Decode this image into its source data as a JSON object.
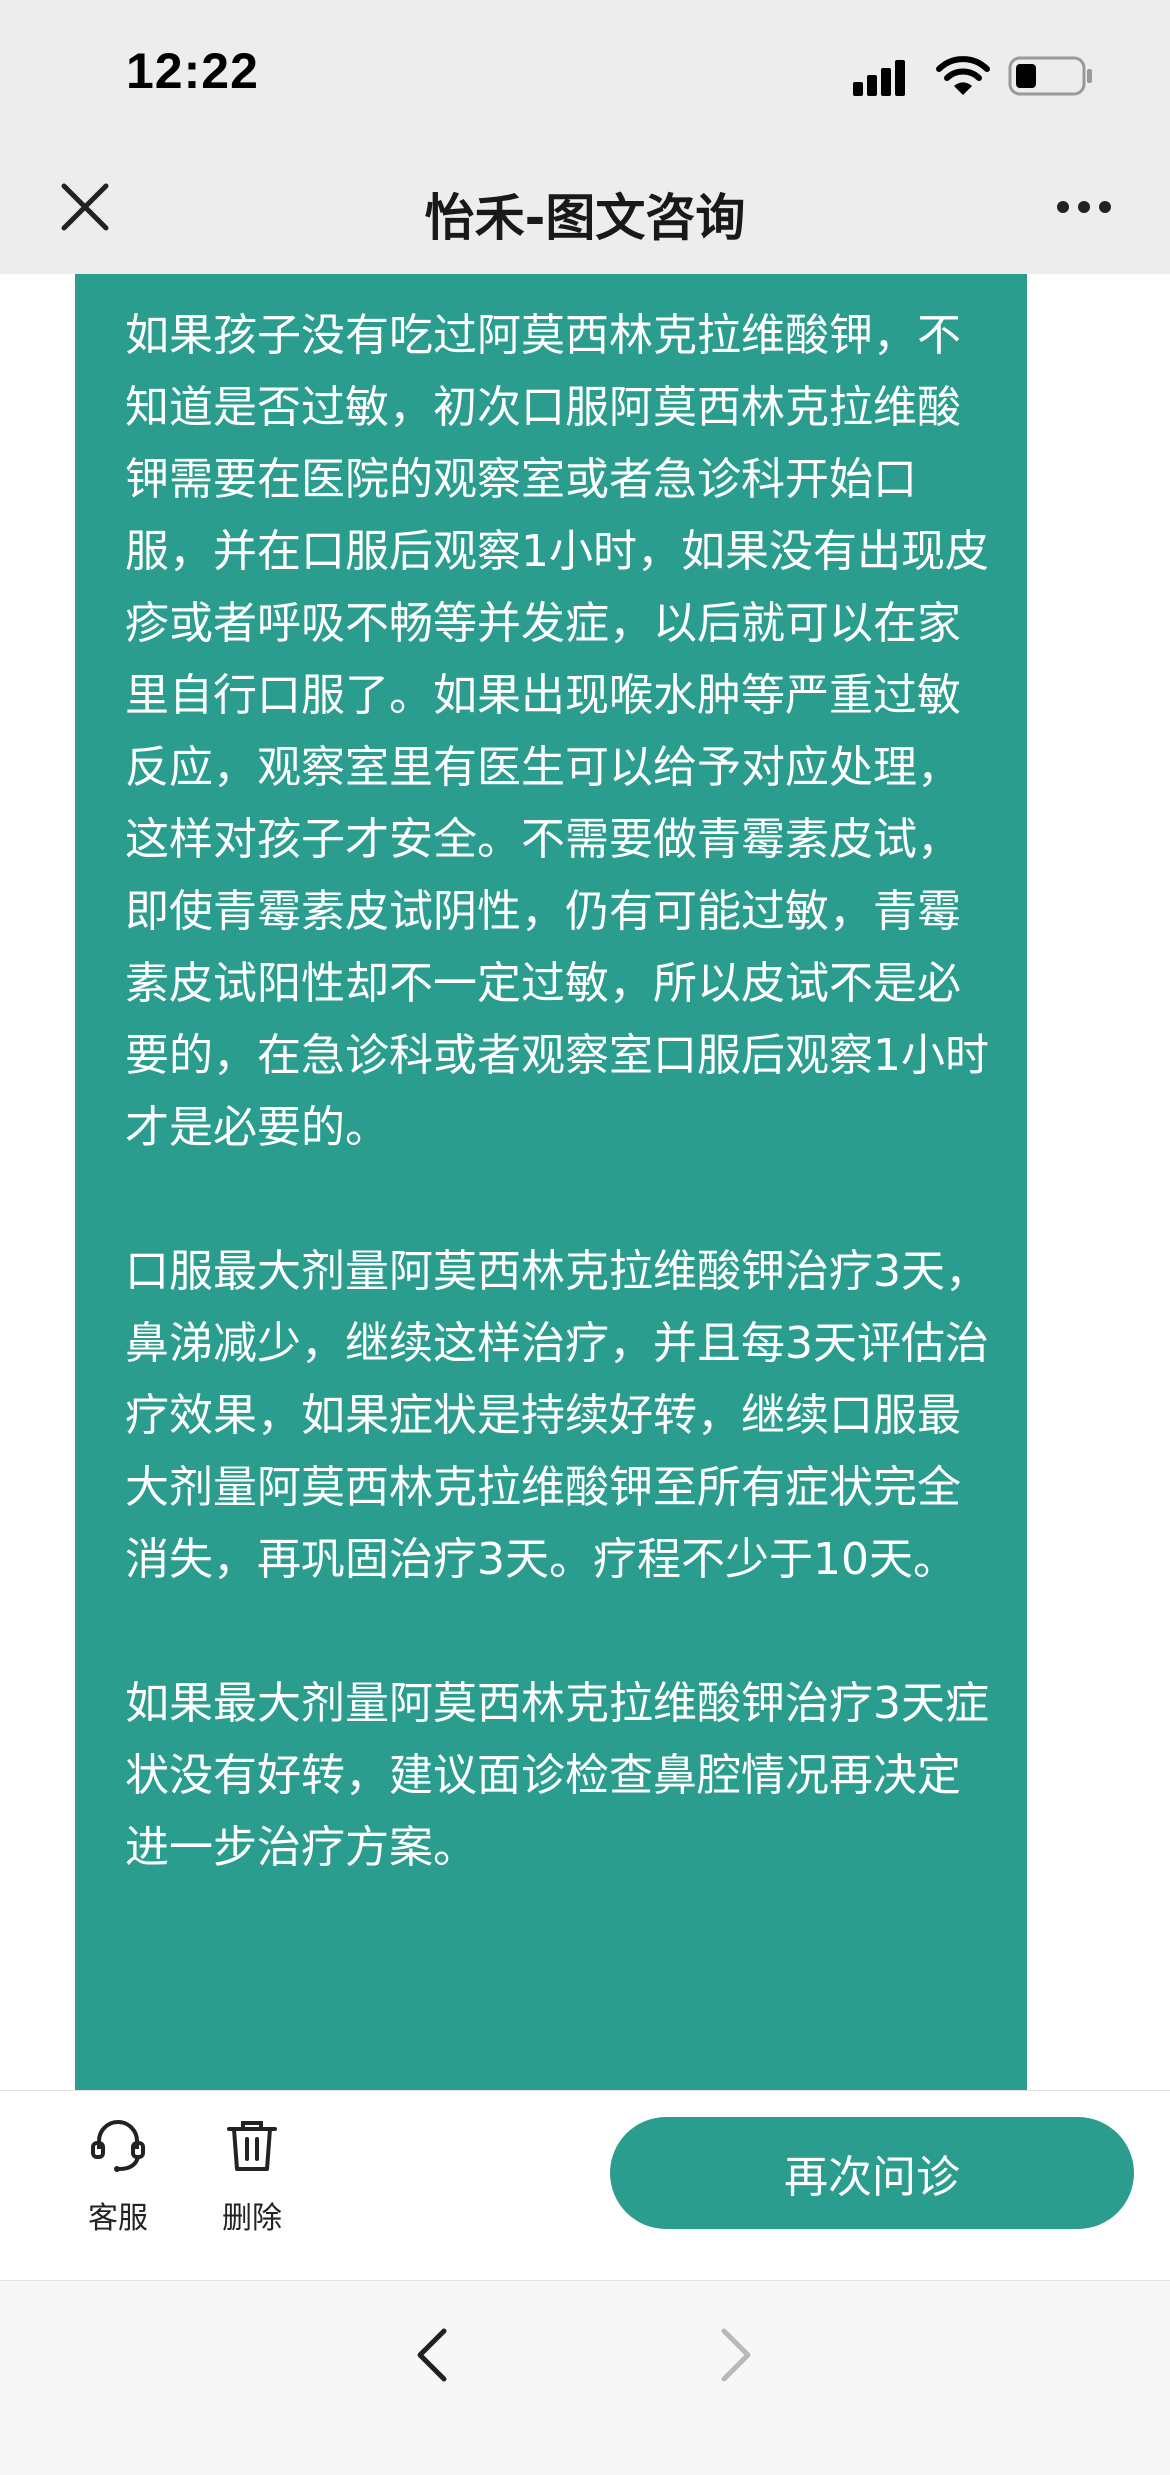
{
  "status_bar": {
    "time": "12:22",
    "icons": [
      "signal-icon",
      "wifi-icon",
      "battery-icon"
    ]
  },
  "nav": {
    "title": "怡禾-图文咨询",
    "close_icon": "close-icon",
    "more_icon": "more-icon"
  },
  "message": {
    "paragraphs": [
      "如果孩子没有吃过阿莫西林克拉维酸钾，不知道是否过敏，初次口服阿莫西林克拉维酸钾需要在医院的观察室或者急诊科开始口服，并在口服后观察1小时，如果没有出现皮疹或者呼吸不畅等并发症，以后就可以在家里自行口服了。如果出现喉水肿等严重过敏反应，观察室里有医生可以给予对应处理，这样对孩子才安全。不需要做青霉素皮试，即使青霉素皮试阴性，仍有可能过敏，青霉素皮试阳性却不一定过敏，所以皮试不是必要的，在急诊科或者观察室口服后观察1小时才是必要的。",
      "口服最大剂量阿莫西林克拉维酸钾治疗3天，鼻涕减少，继续这样治疗，并且每3天评估治疗效果，如果症状是持续好转，继续口服最大剂量阿莫西林克拉维酸钾至所有症状完全消失，再巩固治疗3天。疗程不少于10天。",
      "如果最大剂量阿莫西林克拉维酸钾治疗3天症状没有好转，建议面诊检查鼻腔情况再决定进一步治疗方案。"
    ],
    "bubble_color": "#2a9d8f"
  },
  "actions": {
    "customer_service_label": "客服",
    "delete_label": "删除",
    "reconsult_label": "再次问诊",
    "accent_color": "#2a9d8f"
  },
  "browser_nav": {
    "back_icon": "back-arrow-icon",
    "forward_icon": "forward-arrow-icon"
  }
}
